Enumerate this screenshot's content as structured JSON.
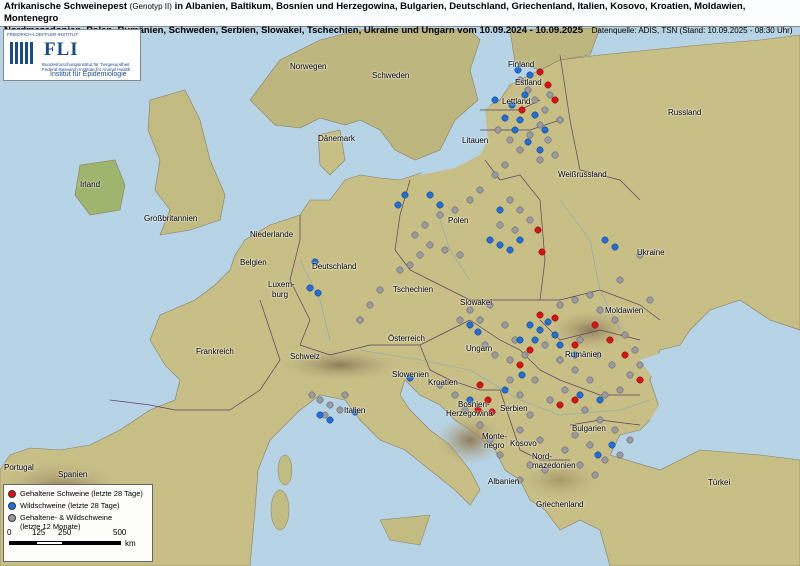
{
  "title": {
    "line1_main": "Afrikanische Schweinepest",
    "line1_genotype": "(Genotyp II)",
    "line1_rest": "in Albanien, Baltikum, Bosnien und Herzegowina, Bulgarien, Deutschland, Griechenland, Italien, Kosovo, Kroatien, Moldawien, Montenegro",
    "line2": "Nordmazedonien, Polen, Rumänien, Schweden, Serbien, Slowakei, Tschechien, Ukraine und Ungarn vom 10.09.2024 - 10.09.2025",
    "source": "Datenquelle: ADIS, TSN  (Stand: 10.09.2025 - 08:30 Uhr)"
  },
  "logo": {
    "institute_top": "FRIEDRICH-LOEFFLER-INSTITUT",
    "acronym": "FLI",
    "sub_de": "Bundesforschungsinstitut für Tiergesundheit",
    "sub_en": "Federal Research Institute for Animal Health",
    "department": "Institut für Epidemiologie"
  },
  "legend": {
    "items": [
      {
        "label": "Gehaltene Schweine (letzte 28 Tage)",
        "color": "#e01010"
      },
      {
        "label": "Wildschweine (letzte 28 Tage)",
        "color": "#1f6fe0"
      },
      {
        "label": "Gehaltene- & Wildschweine",
        "label2": "(letzte 12 Monate)",
        "color": "#9a9aa2"
      }
    ],
    "scale_ticks": [
      "0",
      "125",
      "250",
      "500"
    ],
    "scale_unit": "km"
  },
  "country_labels": [
    {
      "id": "norwegen",
      "text": "Norwegen"
    },
    {
      "id": "schweden",
      "text": "Schweden"
    },
    {
      "id": "finland",
      "text": "Finland"
    },
    {
      "id": "estland",
      "text": "Estland"
    },
    {
      "id": "lettland",
      "text": "Lettland"
    },
    {
      "id": "litauen",
      "text": "Litauen"
    },
    {
      "id": "russland",
      "text": "Russland"
    },
    {
      "id": "weissrussland",
      "text": "Weißrussland"
    },
    {
      "id": "daenemark",
      "text": "Dänemark"
    },
    {
      "id": "irland",
      "text": "Irland"
    },
    {
      "id": "grossbritannien",
      "text": "Großbritannien"
    },
    {
      "id": "niederlande",
      "text": "Niederlande"
    },
    {
      "id": "belgien",
      "text": "Belgien"
    },
    {
      "id": "luxemburg",
      "text": "Luxem-"
    },
    {
      "id": "luxemburg2",
      "text": "burg"
    },
    {
      "id": "deutschland",
      "text": "Deutschland"
    },
    {
      "id": "polen",
      "text": "Polen"
    },
    {
      "id": "tschechien",
      "text": "Tschechien"
    },
    {
      "id": "slowakei",
      "text": "Slowakei"
    },
    {
      "id": "ukraine",
      "text": "Ukraine"
    },
    {
      "id": "moldawien",
      "text": "Moldawien"
    },
    {
      "id": "frankreich",
      "text": "Frankreich"
    },
    {
      "id": "schweiz",
      "text": "Schweiz"
    },
    {
      "id": "oesterreich",
      "text": "Österreich"
    },
    {
      "id": "ungarn",
      "text": "Ungarn"
    },
    {
      "id": "rumaenien",
      "text": "Rumänien"
    },
    {
      "id": "slowenien",
      "text": "Slowenien"
    },
    {
      "id": "kroatien",
      "text": "Kroatien"
    },
    {
      "id": "bosnien",
      "text": "Bosnien-"
    },
    {
      "id": "herzegowina",
      "text": "Herzegowina"
    },
    {
      "id": "serbien",
      "text": "Serbien"
    },
    {
      "id": "italien",
      "text": "Italien"
    },
    {
      "id": "montenegro",
      "text": "Monte-"
    },
    {
      "id": "montenegro2",
      "text": "negro"
    },
    {
      "id": "kosovo",
      "text": "Kosovo"
    },
    {
      "id": "nordmazedonien",
      "text": "Nord-"
    },
    {
      "id": "nordmazedonien2",
      "text": "mazedonien"
    },
    {
      "id": "bulgarien",
      "text": "Bulgarien"
    },
    {
      "id": "albanien",
      "text": "Albanien"
    },
    {
      "id": "griechenland",
      "text": "Griechenland"
    },
    {
      "id": "tuerkei",
      "text": "Türkei"
    },
    {
      "id": "portugal",
      "text": "Portugal"
    },
    {
      "id": "spanien",
      "text": "Spanien"
    }
  ],
  "colors": {
    "sea": "#b7d3e6",
    "land": "#c9c28a",
    "land_green": "#9fb56d",
    "mountain": "#9a8a64",
    "border": "#4a3a4a",
    "domestic_pigs": "#e01010",
    "wild_boar": "#1f6fe0",
    "twelve_months": "#9a9aa2"
  }
}
